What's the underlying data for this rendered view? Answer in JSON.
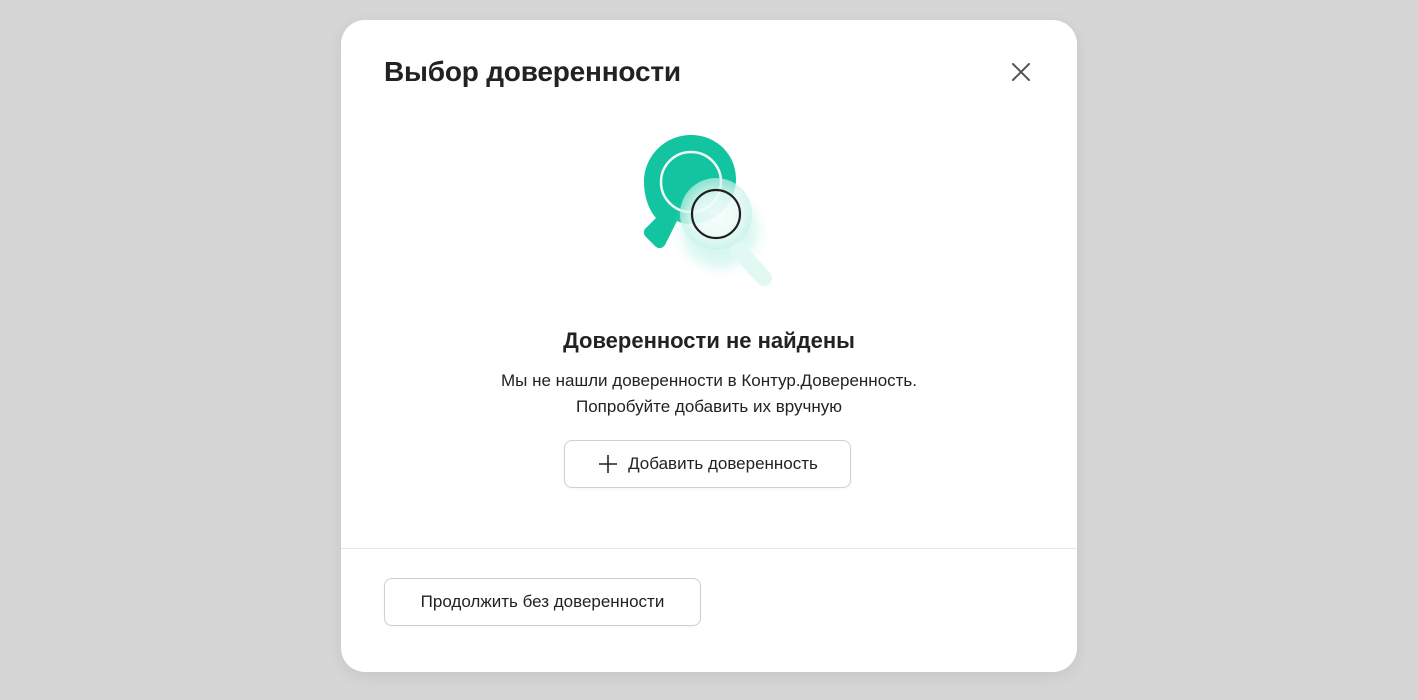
{
  "dialog": {
    "title": "Выбор доверенности",
    "close_icon": "close-icon"
  },
  "empty_state": {
    "illustration_icon": "search-not-found-icon",
    "title": "Доверенности не найдены",
    "text_line1": "Мы не нашли доверенности в Контур.Доверенность.",
    "text_line2": "Попробуйте добавить их вручную",
    "add_button_label": "Добавить доверенность",
    "add_button_icon": "plus-icon"
  },
  "footer": {
    "continue_button_label": "Продолжить без доверенности"
  },
  "colors": {
    "accent": "#1cc0a0",
    "text": "#222222",
    "overlay": "#d6d6d6"
  }
}
